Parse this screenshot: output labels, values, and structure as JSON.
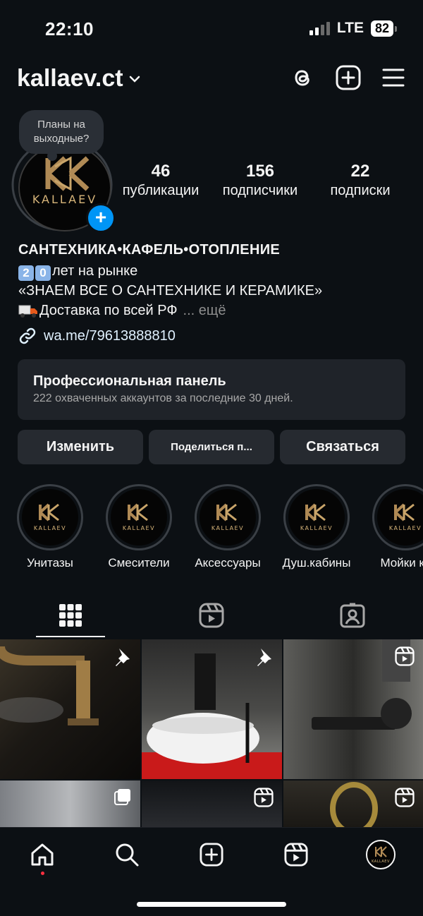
{
  "status": {
    "time": "22:10",
    "network": "LTE",
    "battery": "82"
  },
  "header": {
    "username": "kallaev.ct",
    "icons": [
      "threads-icon",
      "create-icon",
      "menu-icon"
    ]
  },
  "profile": {
    "note": "Планы на выходные?",
    "logo_text": "KALLAEV",
    "stats": [
      {
        "value": "46",
        "label": "публикации"
      },
      {
        "value": "156",
        "label": "подписчики"
      },
      {
        "value": "22",
        "label": "подписки"
      }
    ]
  },
  "bio": {
    "name": "САНТЕХНИКА•КАФЕЛЬ•ОТОПЛЕНИЕ",
    "digit1": "2",
    "digit2": "0",
    "line1": "лет на рынке",
    "line2": "«ЗНАЕМ ВСЕ О САНТЕХНИКЕ И КЕРАМИКЕ»",
    "line3": "Доставка по всей РФ",
    "more": "... ещё",
    "link": "wa.me/79613888810"
  },
  "panel": {
    "title": "Профессиональная панель",
    "subtitle": "222 охваченных аккаунтов за последние 30 дней."
  },
  "buttons": {
    "edit": "Изменить",
    "share": "Поделиться п...",
    "contact": "Связаться"
  },
  "highlights": [
    {
      "label": "Унитазы"
    },
    {
      "label": "Смесители"
    },
    {
      "label": "Аксессуары"
    },
    {
      "label": "Душ.кабины"
    },
    {
      "label": "Мойки ку"
    }
  ],
  "tabs": [
    "grid-icon",
    "reels-icon",
    "tagged-icon"
  ],
  "nav": [
    "home-icon",
    "search-icon",
    "create-icon",
    "reels-icon",
    "profile-avatar"
  ]
}
